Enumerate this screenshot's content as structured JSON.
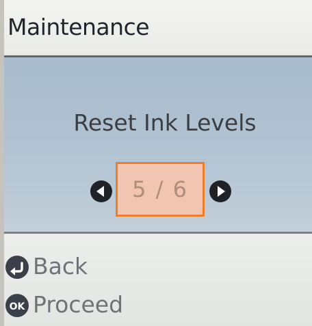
{
  "screen": {
    "title": "Maintenance"
  },
  "main": {
    "message": "Reset Ink Levels",
    "pager": {
      "current": 5,
      "total": 6,
      "label": "5 / 6"
    }
  },
  "footer": {
    "back": {
      "icon": "back-arrow-icon",
      "label": "Back"
    },
    "proceed": {
      "icon": "ok-icon",
      "icon_text": "OK",
      "label": "Proceed"
    }
  },
  "colors": {
    "title_bg": "#eeefec",
    "panel_bg": "#b2c3d2",
    "selection_border": "#ec7d2a",
    "selection_fill": "#f1c5b2",
    "footer_bg": "#e7e9e6",
    "icon_fill": "#1f2227"
  }
}
